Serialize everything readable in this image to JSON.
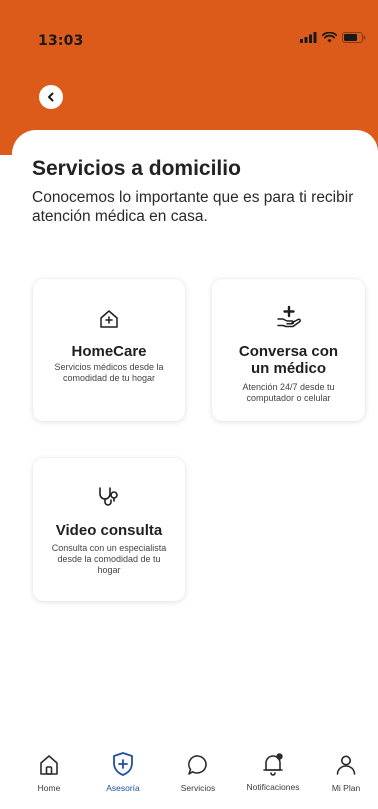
{
  "status_bar": {
    "time": "13:03"
  },
  "header": {
    "background_color": "#dc5a1a"
  },
  "page": {
    "title": "Servicios a domicilio",
    "description": "Conocemos lo importante que es para ti recibir atención médica en casa."
  },
  "cards": [
    {
      "icon": "house-plus-icon",
      "title": "HomeCare",
      "description": "Servicios médicos desde la comodidad de tu hogar"
    },
    {
      "icon": "hand-plus-icon",
      "title": "Conversa con un médico",
      "description": "Atención 24/7 desde tu computador o celular"
    },
    {
      "icon": "stethoscope-icon",
      "title": "Video consulta",
      "description": "Consulta con un especialista desde la comodidad de tu hogar"
    }
  ],
  "tabbar": {
    "active_color": "#1f4f9d",
    "items": [
      {
        "label": "Home",
        "icon": "home-icon"
      },
      {
        "label": "Asesoría",
        "icon": "shield-plus-icon",
        "active": true
      },
      {
        "label": "Servicios",
        "icon": "chat-bubble-icon"
      },
      {
        "label": "Notificaciones",
        "icon": "bell-icon"
      },
      {
        "label": "Mi Plan",
        "icon": "person-icon"
      }
    ]
  }
}
